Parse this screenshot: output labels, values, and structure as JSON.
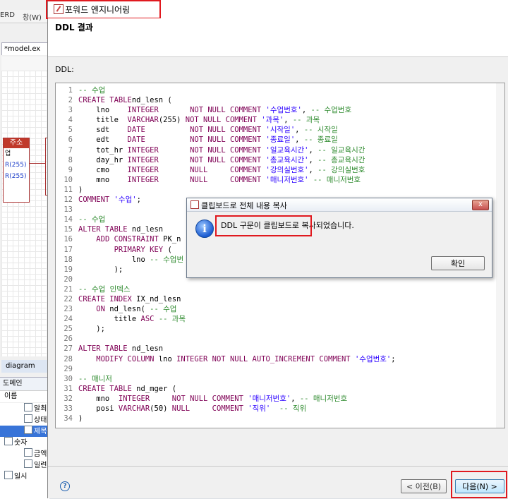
{
  "background_window": {
    "menu_items": [
      "ERD",
      "창(W)"
    ],
    "editor_tab": "*model.ex",
    "entity": {
      "name": "주소",
      "rows": [
        "업",
        "",
        "R(255)",
        "R(255)"
      ]
    },
    "diagram_tab": "diagram",
    "domain_panel": {
      "title": "도메인",
      "column": "이름",
      "items": [
        {
          "label": "알최",
          "selected": false,
          "indent": 2
        },
        {
          "label": "상태",
          "selected": false,
          "indent": 2
        },
        {
          "label": "제목",
          "selected": true,
          "indent": 2
        },
        {
          "label": "숫자",
          "selected": false,
          "indent": 1
        },
        {
          "label": "금액",
          "selected": false,
          "indent": 2
        },
        {
          "label": "일련",
          "selected": false,
          "indent": 2
        },
        {
          "label": "일시",
          "selected": false,
          "indent": 1
        }
      ]
    }
  },
  "wizard": {
    "window_title": "포워드 엔지니어링",
    "header_title": "DDL 결과",
    "ddl_label": "DDL:",
    "code_lines": [
      [
        [
          "cm",
          "-- 수업"
        ]
      ],
      [
        [
          "kw",
          "CREATE TABLE"
        ],
        [
          "",
          "nd_lesn ("
        ]
      ],
      [
        [
          "",
          "    lno    "
        ],
        [
          "kw",
          "INTEGER"
        ],
        [
          "",
          "       "
        ],
        [
          "kw",
          "NOT NULL COMMENT"
        ],
        [
          "",
          ""
        ],
        [
          "str",
          " '수업번호'"
        ],
        [
          "",
          ", "
        ],
        [
          "cm",
          "-- 수업번호"
        ]
      ],
      [
        [
          "",
          "    title  "
        ],
        [
          "kw",
          "VARCHAR"
        ],
        [
          "",
          "(255) "
        ],
        [
          "kw",
          "NOT NULL COMMENT"
        ],
        [
          "str",
          " '과목'"
        ],
        [
          "",
          ", "
        ],
        [
          "cm",
          "-- 과목"
        ]
      ],
      [
        [
          "",
          "    sdt    "
        ],
        [
          "kw",
          "DATE"
        ],
        [
          "",
          "          "
        ],
        [
          "kw",
          "NOT NULL COMMENT"
        ],
        [
          "str",
          " '시작일'"
        ],
        [
          "",
          ", "
        ],
        [
          "cm",
          "-- 시작일"
        ]
      ],
      [
        [
          "",
          "    edt    "
        ],
        [
          "kw",
          "DATE"
        ],
        [
          "",
          "          "
        ],
        [
          "kw",
          "NOT NULL COMMENT"
        ],
        [
          "str",
          " '종료일'"
        ],
        [
          "",
          ", "
        ],
        [
          "cm",
          "-- 종료일"
        ]
      ],
      [
        [
          "",
          "    tot_hr "
        ],
        [
          "kw",
          "INTEGER"
        ],
        [
          "",
          "       "
        ],
        [
          "kw",
          "NOT NULL COMMENT"
        ],
        [
          "str",
          " '일교육시간'"
        ],
        [
          "",
          ", "
        ],
        [
          "cm",
          "-- 일교육시간"
        ]
      ],
      [
        [
          "",
          "    day_hr "
        ],
        [
          "kw",
          "INTEGER"
        ],
        [
          "",
          "       "
        ],
        [
          "kw",
          "NOT NULL COMMENT"
        ],
        [
          "str",
          " '총교육시간'"
        ],
        [
          "",
          ", "
        ],
        [
          "cm",
          "-- 총교육시간"
        ]
      ],
      [
        [
          "",
          "    cmo    "
        ],
        [
          "kw",
          "INTEGER"
        ],
        [
          "",
          "       "
        ],
        [
          "kw",
          "NULL     COMMENT"
        ],
        [
          "str",
          " '강의실번호'"
        ],
        [
          "",
          ", "
        ],
        [
          "cm",
          "-- 강의실번호"
        ]
      ],
      [
        [
          "",
          "    mno    "
        ],
        [
          "kw",
          "INTEGER"
        ],
        [
          "",
          "       "
        ],
        [
          "kw",
          "NULL     COMMENT"
        ],
        [
          "str",
          " '매니저번호'"
        ],
        [
          "",
          " "
        ],
        [
          "cm",
          "-- 매니저번호"
        ]
      ],
      [
        [
          "",
          ")"
        ]
      ],
      [
        [
          "kw",
          "COMMENT"
        ],
        [
          "str",
          " '수업'"
        ],
        [
          "",
          ";"
        ]
      ],
      [
        [
          "",
          ""
        ]
      ],
      [
        [
          "cm",
          "-- 수업"
        ]
      ],
      [
        [
          "kw",
          "ALTER TABLE"
        ],
        [
          "",
          " nd_lesn"
        ]
      ],
      [
        [
          "",
          "    "
        ],
        [
          "kw",
          "ADD CONSTRAINT"
        ],
        [
          "",
          " PK_n"
        ]
      ],
      [
        [
          "",
          "        "
        ],
        [
          "kw",
          "PRIMARY KEY"
        ],
        [
          "",
          " ("
        ]
      ],
      [
        [
          "",
          "            lno "
        ],
        [
          "cm",
          "-- 수업번"
        ]
      ],
      [
        [
          "",
          "        );"
        ]
      ],
      [
        [
          "",
          ""
        ]
      ],
      [
        [
          "cm",
          "-- 수업 인덱스"
        ]
      ],
      [
        [
          "kw",
          "CREATE INDEX"
        ],
        [
          "",
          " IX_nd_lesn"
        ]
      ],
      [
        [
          "",
          "    "
        ],
        [
          "kw",
          "ON"
        ],
        [
          "",
          " nd_lesn( "
        ],
        [
          "cm",
          "-- 수업"
        ]
      ],
      [
        [
          "",
          "        title "
        ],
        [
          "kw",
          "ASC"
        ],
        [
          "",
          " "
        ],
        [
          "cm",
          "-- 과목"
        ]
      ],
      [
        [
          "",
          "    );"
        ]
      ],
      [
        [
          "",
          ""
        ]
      ],
      [
        [
          "kw",
          "ALTER TABLE"
        ],
        [
          "",
          " nd_lesn"
        ]
      ],
      [
        [
          "",
          "    "
        ],
        [
          "kw",
          "MODIFY COLUMN"
        ],
        [
          "",
          " lno "
        ],
        [
          "kw",
          "INTEGER NOT NULL AUTO_INCREMENT COMMENT"
        ],
        [
          "str",
          " '수업번호'"
        ],
        [
          "",
          ";"
        ]
      ],
      [
        [
          "",
          ""
        ]
      ],
      [
        [
          "cm",
          "-- 매니저"
        ]
      ],
      [
        [
          "kw",
          "CREATE TABLE"
        ],
        [
          "",
          " nd_mger ("
        ]
      ],
      [
        [
          "",
          "    mno  "
        ],
        [
          "kw",
          "INTEGER"
        ],
        [
          "",
          "     "
        ],
        [
          "kw",
          "NOT NULL COMMENT"
        ],
        [
          "str",
          " '매니저번호'"
        ],
        [
          "",
          ", "
        ],
        [
          "cm",
          "-- 매니저번호"
        ]
      ],
      [
        [
          "",
          "    posi "
        ],
        [
          "kw",
          "VARCHAR"
        ],
        [
          "",
          "(50) "
        ],
        [
          "kw",
          "NULL     COMMENT"
        ],
        [
          "str",
          " '직위'"
        ],
        [
          "",
          "  "
        ],
        [
          "cm",
          "-- 직위"
        ]
      ],
      [
        [
          "",
          ")"
        ]
      ]
    ],
    "back_button": "< 이전(B)",
    "next_button": "다음(N) >"
  },
  "dialog": {
    "title": "클립보드로 전체 내용 복사",
    "message": "DDL 구문이 클립보드로 복사되었습니다.",
    "ok_button": "확인",
    "close_glyph": "x"
  },
  "colors": {
    "highlight_box": "#e0191f",
    "keyword": "#7f0055",
    "comment": "#2d8a2d",
    "string": "#2a00ff"
  }
}
